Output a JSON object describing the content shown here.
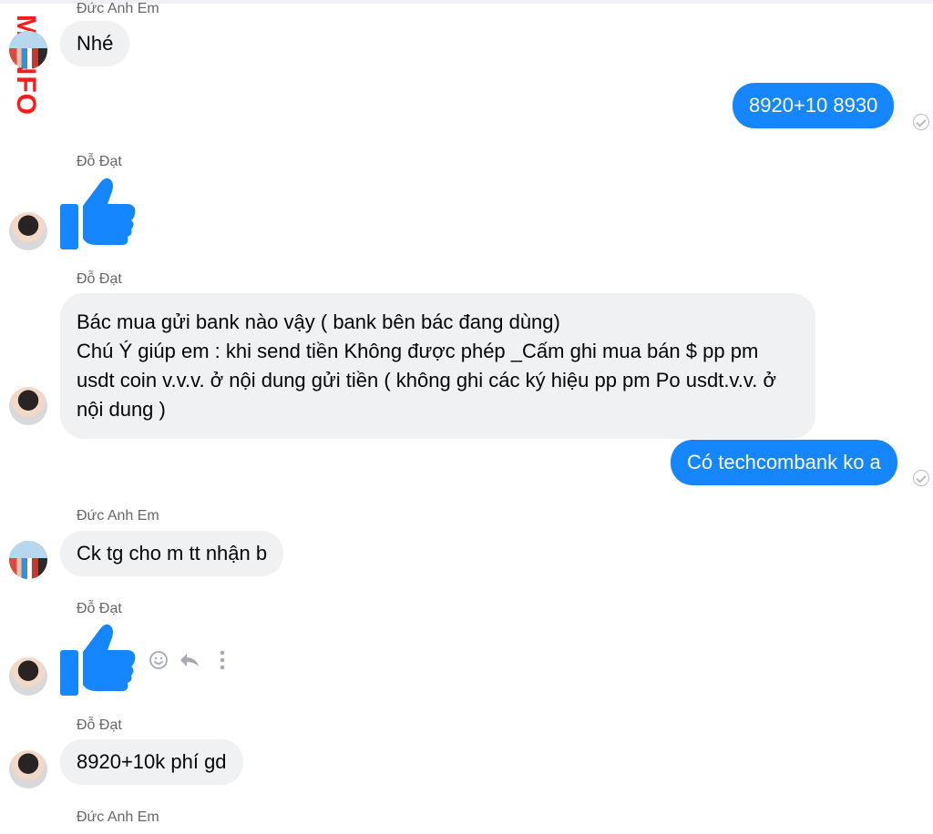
{
  "watermark": "M.INFO",
  "messages": [
    {
      "sender": "Đức Anh Em"
    },
    {
      "text": "Nhé"
    },
    {
      "text": "8920+10 8930"
    },
    {
      "sender": "Đỗ Đạt"
    },
    {
      "sender": "Đỗ Đạt",
      "text": "Bác mua gửi bank nào vậy ( bank bên bác đang dùng)\nChú Ý giúp em : khi send tiền Không được phép _Cấm ghi mua bán $ pp pm usdt coin v.v.v. ở nội dung gửi tiền ( không ghi các ký hiệu pp pm Po usdt.v.v. ở nội dung )"
    },
    {
      "text": "Có techcombank ko a"
    },
    {
      "sender": "Đức Anh Em",
      "text": "Ck tg cho m tt nhận b"
    },
    {
      "sender": "Đỗ Đạt"
    },
    {
      "sender": "Đỗ Đạt",
      "text": "8920+10k phí gd"
    },
    {
      "sender": "Đức Anh Em"
    }
  ],
  "icons": {
    "like": "thumbs-up-icon",
    "emoji": "smiley-icon",
    "reply": "reply-icon",
    "more": "more-vertical-icon",
    "seen": "sent-check-icon"
  },
  "colors": {
    "outgoing_bubble": "#1686FF",
    "incoming_bubble": "#F0F1F3",
    "like": "#1686FF",
    "watermark": "#FF1A1A"
  }
}
